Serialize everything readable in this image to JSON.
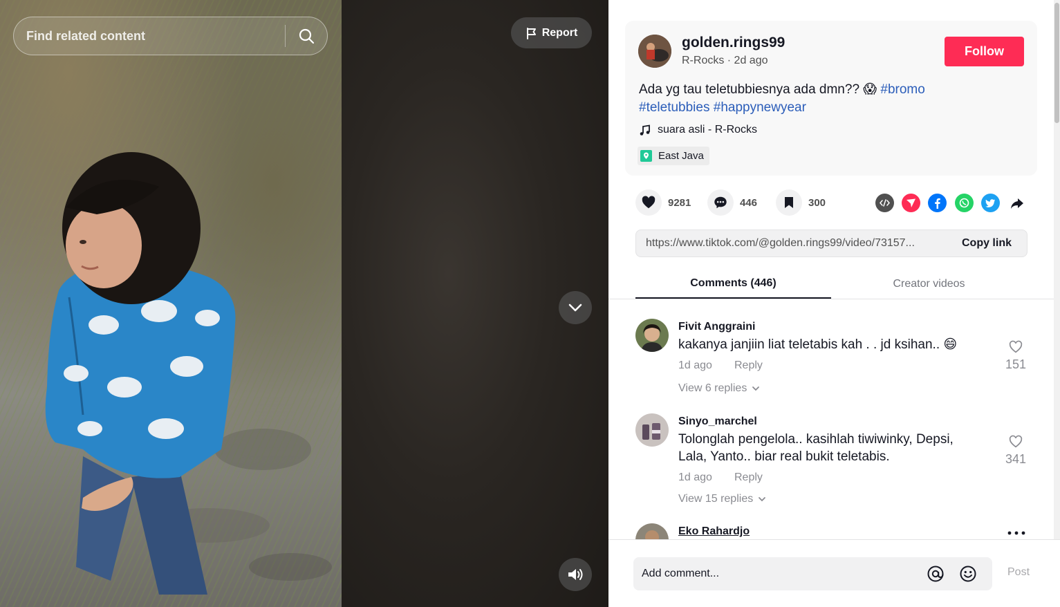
{
  "search": {
    "placeholder": "Find related content"
  },
  "video_controls": {
    "report_label": "Report"
  },
  "author": {
    "username": "golden.rings99",
    "subtitle": "R-Rocks · 2d ago",
    "follow_label": "Follow"
  },
  "caption": {
    "text": "Ada yg tau teletubbiesnya ada dmn?? ",
    "emoji": "😱",
    "hashtags": [
      "#bromo",
      "#teletubbies",
      "#happynewyear"
    ]
  },
  "music": {
    "label": "suara asli - R-Rocks"
  },
  "location": {
    "label": "East Java"
  },
  "actions": {
    "likes": "9281",
    "comments": "446",
    "saves": "300"
  },
  "share": {
    "icons": [
      "embed-icon",
      "send-to-friends-icon",
      "facebook-icon",
      "whatsapp-icon",
      "twitter-icon",
      "share-arrow-icon"
    ],
    "link": "https://www.tiktok.com/@golden.rings99/video/73157...",
    "copy_label": "Copy link"
  },
  "tabs": {
    "comments": "Comments (446)",
    "creator": "Creator videos"
  },
  "comments": [
    {
      "user": "Fivit Anggraini",
      "text": "kakanya janjiin liat teletabis kah . . jd ksihan.. 😄",
      "time": "1d ago",
      "reply": "Reply",
      "view_replies": "View 6 replies",
      "likes": "151"
    },
    {
      "user": "Sinyo_marchel",
      "text_line1": "Tolonglah pengelola.. kasihlah tiwiwinky, Depsi,",
      "text_line2": "Lala, Yanto.. biar real bukit teletabis.",
      "time": "1d ago",
      "reply": "Reply",
      "view_replies": "View 15 replies",
      "likes": "341"
    },
    {
      "user": "Eko Rahardjo"
    }
  ],
  "composer": {
    "placeholder": "Add comment...",
    "post_label": "Post"
  },
  "colors": {
    "follow": "#fe2c55",
    "hashtag": "#2b5db9",
    "text_primary": "#161823",
    "text_muted": "#8a8b91"
  }
}
